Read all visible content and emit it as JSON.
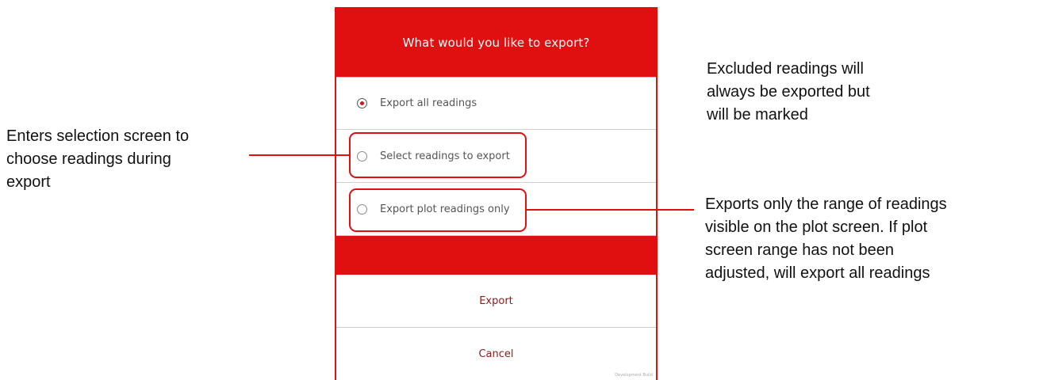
{
  "dialog": {
    "title": "What would you like to export?",
    "options": [
      {
        "label": "Export all readings",
        "selected": true
      },
      {
        "label": "Select readings to export",
        "selected": false
      },
      {
        "label": "Export plot readings only",
        "selected": false
      }
    ],
    "export_label": "Export",
    "cancel_label": "Cancel",
    "watermark": "Development Build"
  },
  "annotations": {
    "left": "Enters selection screen to\nchoose readings during\nexport",
    "right_top": "Excluded readings will\nalways be exported but\nwill be marked",
    "right_bottom": "Exports only the range of readings\nvisible on the plot screen. If plot\nscreen range has not been\nadjusted, will export all readings"
  },
  "colors": {
    "accent": "#e01010",
    "action_text": "#8a1c1c"
  }
}
